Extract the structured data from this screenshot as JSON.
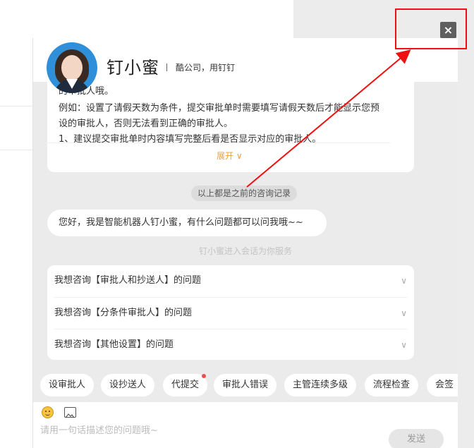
{
  "close_label": "×",
  "header": {
    "name": "钉小蜜",
    "tagline": "酷公司，用钉钉"
  },
  "history": {
    "lines": [
      "的审批人哦。",
      "例如：设置了请假天数为条件，提交审批单时需要填写请假天数后才能显示您预",
      "设的审批人，否则无法看到正确的审批人。",
      "1、建议提交审批单时内容填写完整后看是否显示对应的审批人。"
    ],
    "expand_label": "展开 ∨"
  },
  "record_pill": "以上都是之前的咨询记录",
  "greeting": "您好，我是智能机器人钉小蜜，有什么问题都可以问我哦~~",
  "session_note": "钉小蜜进入会话为你服务",
  "faq": [
    "我想咨询【审批人和抄送人】的问题",
    "我想咨询【分条件审批人】的问题",
    "我想咨询【其他设置】的问题"
  ],
  "faq_chevron": "∨",
  "chips": [
    "设审批人",
    "设抄送人",
    "代提交",
    "审批人错误",
    "主管连续多级",
    "流程检查",
    "会签"
  ],
  "input": {
    "placeholder": "请用一句话描述您的问题哦~"
  },
  "send_label": "发送",
  "colors": {
    "accent": "#e6a23c",
    "annotation": "#e11",
    "badge": "#f04d4d"
  }
}
